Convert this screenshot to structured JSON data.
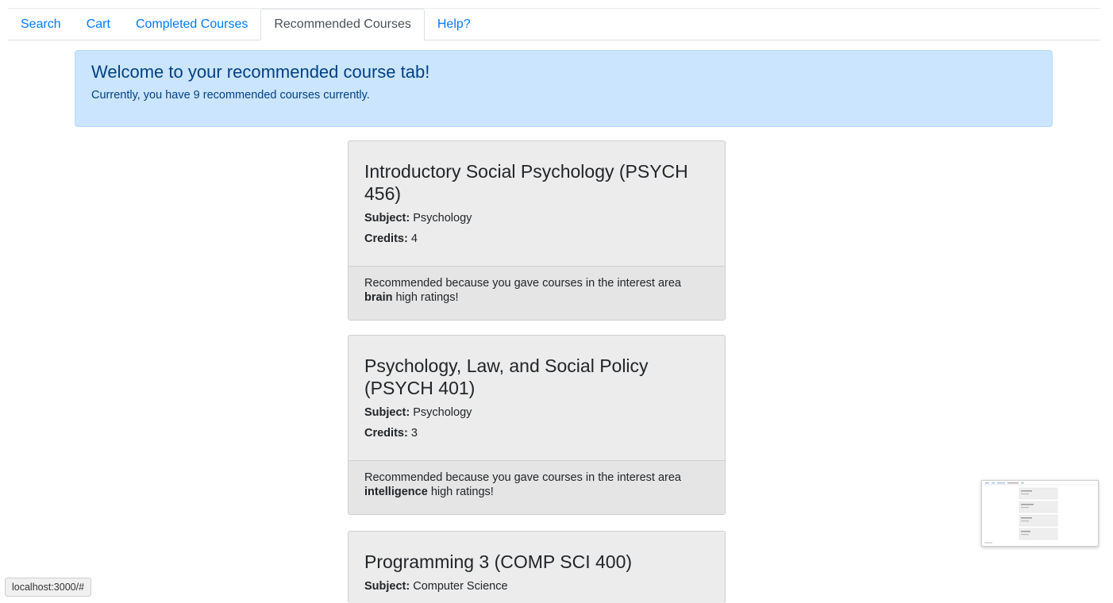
{
  "tabs": [
    {
      "label": "Search"
    },
    {
      "label": "Cart"
    },
    {
      "label": "Completed Courses"
    },
    {
      "label": "Recommended Courses"
    },
    {
      "label": "Help?"
    }
  ],
  "alert": {
    "heading": "Welcome to your recommended course tab!",
    "text": "Currently, you have 9 recommended courses currently."
  },
  "labels": {
    "subject": "Subject:",
    "credits": "Credits:"
  },
  "courses": [
    {
      "title": "Introductory Social Psychology (PSYCH 456)",
      "subject": "Psychology",
      "credits": "4",
      "reason_prefix": "Recommended because you gave courses in the interest area",
      "interest": "brain",
      "reason_suffix": "high ratings!"
    },
    {
      "title": "Psychology, Law, and Social Policy (PSYCH 401)",
      "subject": "Psychology",
      "credits": "3",
      "reason_prefix": "Recommended because you gave courses in the interest area",
      "interest": "intelligence",
      "reason_suffix": "high ratings!"
    },
    {
      "title": "Programming 3 (COMP SCI 400)",
      "subject": "Computer Science"
    }
  ],
  "status_bar": {
    "url": "localhost:3000/#"
  }
}
